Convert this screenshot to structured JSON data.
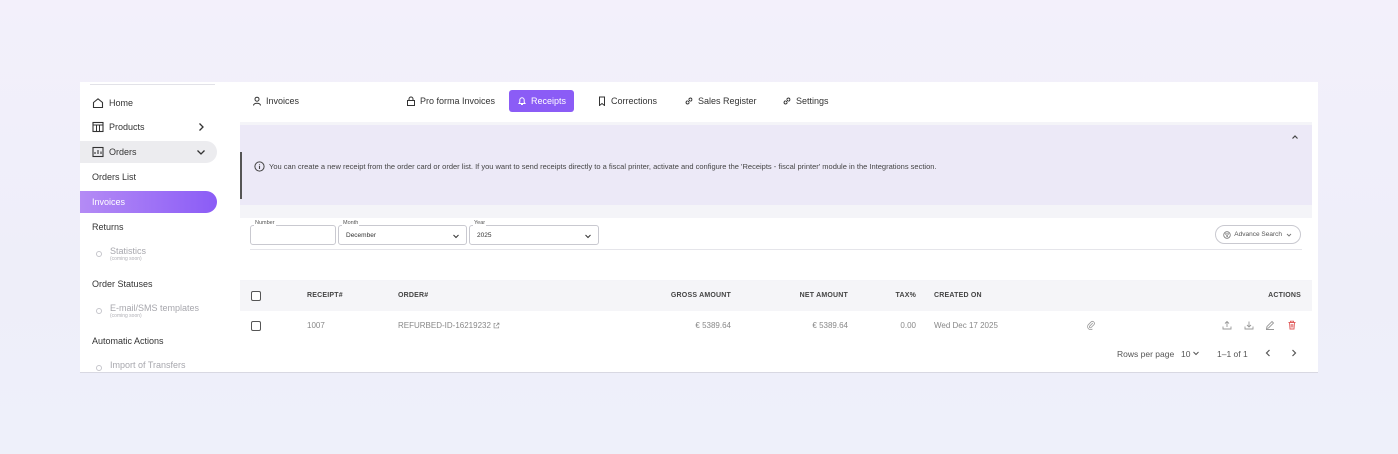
{
  "sidebar": {
    "home": "Home",
    "products": "Products",
    "orders": "Orders",
    "orders_list": "Orders List",
    "invoices": "Invoices",
    "returns": "Returns",
    "statistics": "Statistics",
    "statistics_sub": "(coming soon)",
    "order_statuses": "Order Statuses",
    "email_templates": "E-mail/SMS templates",
    "email_templates_sub": "(coming soon)",
    "automatic_actions": "Automatic Actions",
    "import_transfers": "Import of Transfers"
  },
  "tabs": {
    "invoices": "Invoices",
    "pro_forma": "Pro forma Invoices",
    "receipts": "Receipts",
    "corrections": "Corrections",
    "sales_register": "Sales Register",
    "settings": "Settings"
  },
  "info": {
    "text": "You can create a new receipt from the order card or order list. If you want to send receipts directly to a fiscal printer, activate and configure the 'Receipts - fiscal printer' module in the Integrations section."
  },
  "filters": {
    "number_label": "Number",
    "number_value": "",
    "month_label": "Month",
    "month_value": "December",
    "year_label": "Year",
    "year_value": "2025",
    "advance_search": "Advance Search"
  },
  "table": {
    "headers": {
      "receipt": "RECEIPT#",
      "order": "ORDER#",
      "gross": "GROSS AMOUNT",
      "net": "NET AMOUNT",
      "tax": "TAX%",
      "created": "CREATED ON",
      "actions": "ACTIONS"
    },
    "rows": [
      {
        "receipt": "1007",
        "order": "REFURBED-ID-16219232",
        "gross": "€ 5389.64",
        "net": "€ 5389.64",
        "tax": "0.00",
        "created": "Wed Dec 17 2025"
      }
    ]
  },
  "pagination": {
    "rows_per_page_label": "Rows per page",
    "rows_per_page": "10",
    "range": "1–1 of 1"
  },
  "colors": {
    "accent": "#8b5cf6",
    "info_bg": "#ece9f7",
    "delete": "#e05a5a"
  }
}
